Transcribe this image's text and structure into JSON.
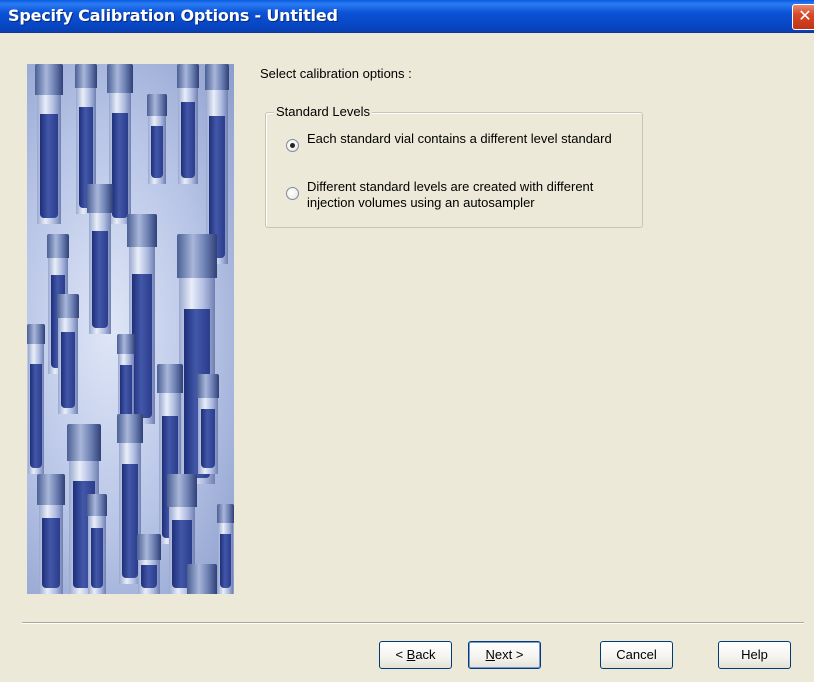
{
  "window": {
    "title": "Specify Calibration Options - Untitled",
    "close_label": "✕"
  },
  "main": {
    "prompt": "Select calibration options :",
    "group": {
      "label": "Standard Levels",
      "options": [
        {
          "label": "Each standard vial contains a different level standard",
          "checked": true
        },
        {
          "label": "Different standard levels are created with different injection volumes using an autosampler",
          "checked": false
        }
      ]
    }
  },
  "buttons": {
    "back_prefix": "< ",
    "back_key": "B",
    "back_rest": "ack",
    "next_key": "N",
    "next_rest": "ext >",
    "cancel": "Cancel",
    "help": "Help"
  },
  "image": {
    "subject": "illustration of sample vials"
  }
}
